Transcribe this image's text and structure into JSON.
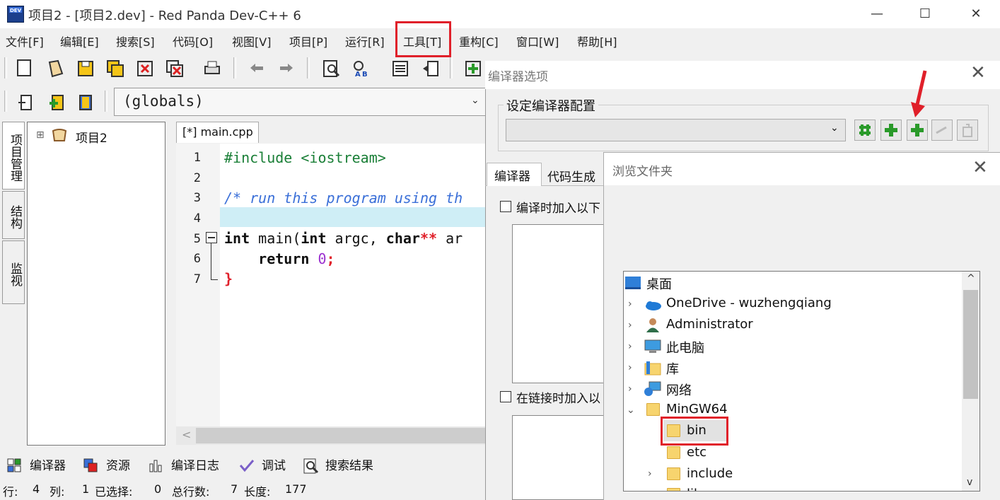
{
  "window": {
    "title": "项目2 - [项目2.dev] - Red Panda Dev-C++ 6",
    "icon_text": "DEV",
    "minimize": "—",
    "maximize": "☐",
    "close": "✕"
  },
  "menu": [
    "文件[F]",
    "编辑[E]",
    "搜索[S]",
    "代码[O]",
    "视图[V]",
    "项目[P]",
    "运行[R]",
    "工具[T]",
    "重构[C]",
    "窗口[W]",
    "帮助[H]"
  ],
  "toolbar": {
    "scope": "(globals)",
    "scope_chevron": "⌄"
  },
  "side_tabs": [
    "项目管理",
    "结构",
    "监视"
  ],
  "project_tree": {
    "expand": "⊞",
    "root": "项目2"
  },
  "editor": {
    "tab": "[*] main.cpp",
    "line_numbers": [
      "1",
      "2",
      "3",
      "4",
      "5",
      "6",
      "7"
    ],
    "lines": {
      "l1": "#include <iostream>",
      "l3": "/* run this program using th",
      "l5_kw": "int",
      "l5_fn": " main(",
      "l5_kw2": "int",
      "l5_arg": " argc, ",
      "l5_kw3": "char",
      "l5_ptr": "**",
      "l5_rest": " ar",
      "l6_kw": "return",
      "l6_num": "0",
      "l6_semi": ";",
      "l7": "}"
    },
    "scroll_left": "<"
  },
  "bottom_tabs": [
    "编译器",
    "资源",
    "编译日志",
    "调试",
    "搜索结果"
  ],
  "status": {
    "row_label": "行:",
    "row": "4",
    "col_label": "列:",
    "col": "1",
    "sel_label": "已选择:",
    "sel": "0",
    "total_label": "总行数:",
    "total": "7",
    "len_label": "长度:",
    "len": "177"
  },
  "compiler_dialog": {
    "title": "编译器选项",
    "close": "✕",
    "config_label": "设定编译器配置",
    "select_chevron": "⌄",
    "tabs": [
      "编译器",
      "代码生成"
    ],
    "check1": "编译时加入以下",
    "check2": "在链接时加入以"
  },
  "browse_dialog": {
    "title": "浏览文件夹",
    "close": "✕",
    "items": [
      "桌面",
      "OneDrive - wuzhengqiang",
      "Administrator",
      "此电脑",
      "库",
      "网络",
      "MinGW64",
      "bin",
      "etc",
      "include",
      "lib"
    ],
    "scroll_up": "^",
    "scroll_down": "v"
  },
  "colors": {
    "highlight": "#e0202a",
    "current_line": "#cfeef6",
    "keyword": "#000000",
    "preprocessor": "#1a7f37",
    "comment": "#3a6fd8",
    "number": "#9b30d0",
    "brace": "#e0202a"
  }
}
